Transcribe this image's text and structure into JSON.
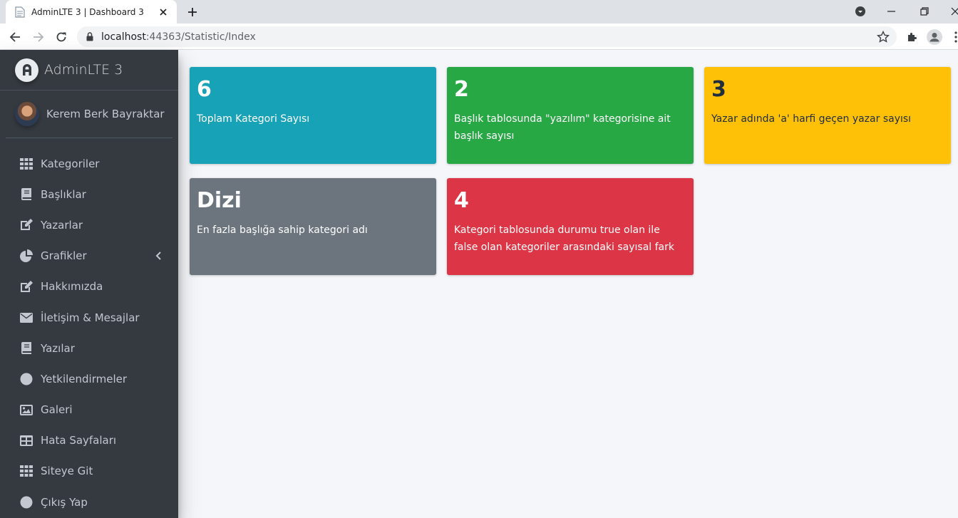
{
  "browser": {
    "tab_title": "AdminLTE 3 | Dashboard 3",
    "url_host": "localhost",
    "url_rest": ":44363/Statistic/Index"
  },
  "sidebar": {
    "brand": "AdminLTE 3",
    "user_name": "Kerem Berk Bayraktar",
    "items": [
      {
        "label": "Kategoriler",
        "icon": "th-icon"
      },
      {
        "label": "Başlıklar",
        "icon": "book-icon"
      },
      {
        "label": "Yazarlar",
        "icon": "edit-icon"
      },
      {
        "label": "Grafikler",
        "icon": "chart-pie-icon",
        "has_arrow": true
      },
      {
        "label": "Hakkımızda",
        "icon": "edit-icon"
      },
      {
        "label": "İletişim & Mesajlar",
        "icon": "envelope-icon"
      },
      {
        "label": "Yazılar",
        "icon": "book-icon"
      },
      {
        "label": "Yetkilendirmeler",
        "icon": "circle-icon"
      },
      {
        "label": "Galeri",
        "icon": "image-icon"
      },
      {
        "label": "Hata Sayfaları",
        "icon": "table-icon"
      },
      {
        "label": "Siteye Git",
        "icon": "th-icon"
      },
      {
        "label": "Çıkış Yap",
        "icon": "circle-icon"
      }
    ]
  },
  "stats": [
    {
      "value": "6",
      "label": "Toplam Kategori Sayısı",
      "color": "#17a2b8"
    },
    {
      "value": "2",
      "label": "Başlık tablosunda \"yazılım\" kategorisine ait başlık sayısı",
      "color": "#28a745"
    },
    {
      "value": "3",
      "label": "Yazar adında 'a' harfi geçen yazar sayısı",
      "color": "#ffc107"
    },
    {
      "value": "Dizi",
      "label": "En fazla başlığa sahip kategori adı",
      "color": "#6c757d"
    },
    {
      "value": "4",
      "label": "Kategori tablosunda durumu true olan ile false olan kategoriler arasındaki sayısal fark",
      "color": "#dc3545"
    }
  ]
}
